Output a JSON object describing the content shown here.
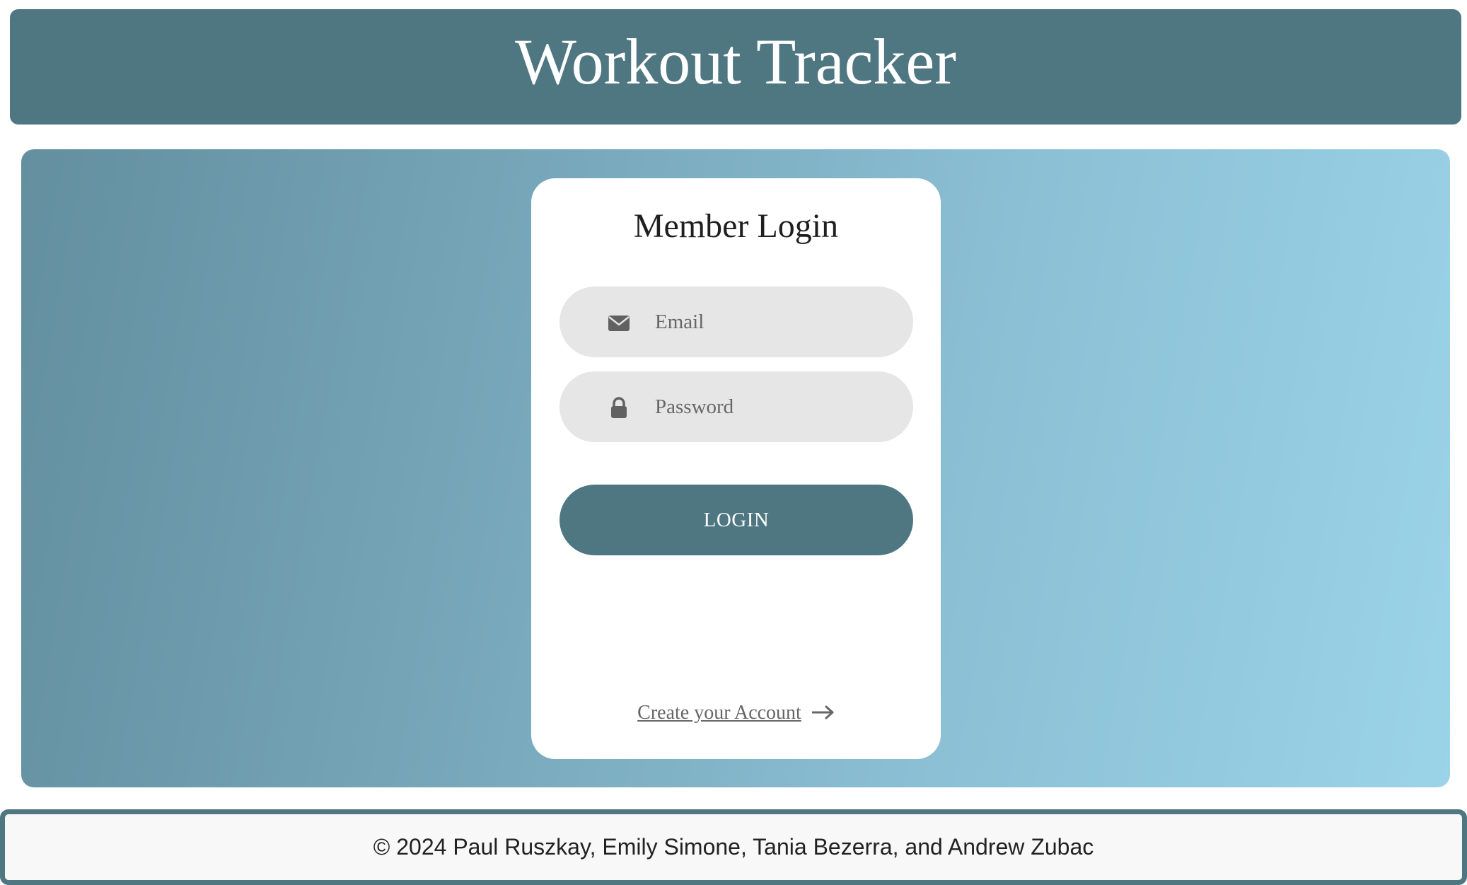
{
  "header": {
    "title": "Workout Tracker"
  },
  "login": {
    "title": "Member Login",
    "email_placeholder": "Email",
    "email_icon": "envelope-icon",
    "password_placeholder": "Password",
    "password_icon": "lock-icon",
    "button_label": "LOGIN",
    "create_account_label": "Create your Account",
    "create_account_icon": "arrow-right-icon"
  },
  "footer": {
    "text": "© 2024 Paul Ruszkay, Emily Simone, Tania Bezerra, and Andrew Zubac"
  },
  "colors": {
    "primary": "#4f7782",
    "field_bg": "#e6e6e6",
    "gradient_start": "#638f9f",
    "gradient_end": "#9bd3e8"
  }
}
